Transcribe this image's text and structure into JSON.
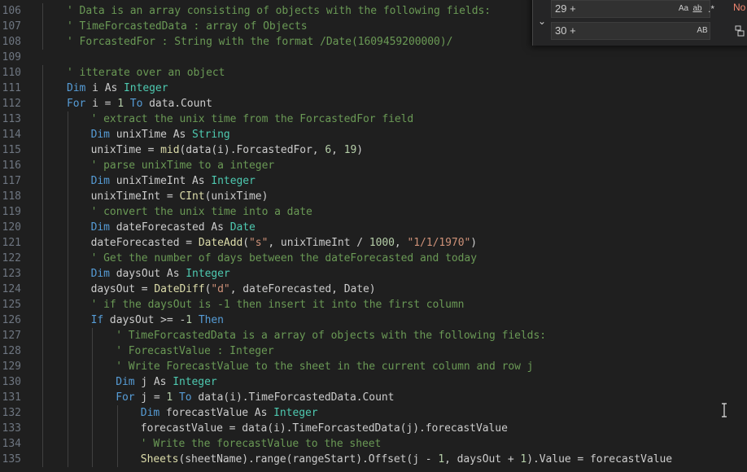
{
  "find_widget": {
    "find_value": "29 +",
    "replace_value": "30 +",
    "match_case_label": "Aa",
    "whole_word_label": "ab",
    "regex_label": ".*",
    "preserve_case_label": "AB",
    "status_text": "No"
  },
  "code_lines": [
    {
      "n": "106",
      "indent": 1,
      "tokens": [
        [
          "cm",
          "' Data is an array consisting of objects with the following fields:"
        ]
      ]
    },
    {
      "n": "107",
      "indent": 1,
      "tokens": [
        [
          "cm",
          "' TimeForcastedData : array of Objects"
        ]
      ]
    },
    {
      "n": "108",
      "indent": 1,
      "tokens": [
        [
          "cm",
          "' ForcastedFor : String with the format /Date(1609459200000)/"
        ]
      ]
    },
    {
      "n": "109",
      "indent": 0,
      "tokens": []
    },
    {
      "n": "110",
      "indent": 1,
      "tokens": [
        [
          "cm",
          "' itterate over an object"
        ]
      ]
    },
    {
      "n": "111",
      "indent": 1,
      "tokens": [
        [
          "kw",
          "Dim"
        ],
        [
          "pl",
          " i "
        ],
        [
          "pl",
          "As"
        ],
        [
          "pl",
          " "
        ],
        [
          "ty",
          "Integer"
        ]
      ]
    },
    {
      "n": "112",
      "indent": 1,
      "tokens": [
        [
          "kw",
          "For"
        ],
        [
          "pl",
          " i = "
        ],
        [
          "nu",
          "1"
        ],
        [
          "pl",
          " "
        ],
        [
          "kw",
          "To"
        ],
        [
          "pl",
          " data.Count"
        ]
      ]
    },
    {
      "n": "113",
      "indent": 2,
      "tokens": [
        [
          "cm",
          "' extract the unix time from the ForcastedFor field"
        ]
      ]
    },
    {
      "n": "114",
      "indent": 2,
      "tokens": [
        [
          "kw",
          "Dim"
        ],
        [
          "pl",
          " unixTime As "
        ],
        [
          "ty",
          "String"
        ]
      ]
    },
    {
      "n": "115",
      "indent": 2,
      "tokens": [
        [
          "pl",
          "unixTime = "
        ],
        [
          "fn",
          "mid"
        ],
        [
          "pl",
          "(data(i).ForcastedFor, "
        ],
        [
          "nu",
          "6"
        ],
        [
          "pl",
          ", "
        ],
        [
          "nu",
          "19"
        ],
        [
          "pl",
          ")"
        ]
      ]
    },
    {
      "n": "116",
      "indent": 2,
      "tokens": [
        [
          "cm",
          "' parse unixTime to a integer"
        ]
      ]
    },
    {
      "n": "117",
      "indent": 2,
      "tokens": [
        [
          "kw",
          "Dim"
        ],
        [
          "pl",
          " unixTimeInt As "
        ],
        [
          "ty",
          "Integer"
        ]
      ]
    },
    {
      "n": "118",
      "indent": 2,
      "tokens": [
        [
          "pl",
          "unixTimeInt = "
        ],
        [
          "fn",
          "CInt"
        ],
        [
          "pl",
          "(unixTime)"
        ]
      ]
    },
    {
      "n": "119",
      "indent": 2,
      "tokens": [
        [
          "cm",
          "' convert the unix time into a date"
        ]
      ]
    },
    {
      "n": "120",
      "indent": 2,
      "tokens": [
        [
          "kw",
          "Dim"
        ],
        [
          "pl",
          " dateForecasted As "
        ],
        [
          "ty",
          "Date"
        ]
      ]
    },
    {
      "n": "121",
      "indent": 2,
      "tokens": [
        [
          "pl",
          "dateForecasted = "
        ],
        [
          "fn",
          "DateAdd"
        ],
        [
          "pl",
          "("
        ],
        [
          "st",
          "\"s\""
        ],
        [
          "pl",
          ", unixTimeInt / "
        ],
        [
          "nu",
          "1000"
        ],
        [
          "pl",
          ", "
        ],
        [
          "st",
          "\"1/1/1970\""
        ],
        [
          "pl",
          ")"
        ]
      ]
    },
    {
      "n": "122",
      "indent": 2,
      "tokens": [
        [
          "cm",
          "' Get the number of days between the dateForecasted and today"
        ]
      ]
    },
    {
      "n": "123",
      "indent": 2,
      "tokens": [
        [
          "kw",
          "Dim"
        ],
        [
          "pl",
          " daysOut As "
        ],
        [
          "ty",
          "Integer"
        ]
      ]
    },
    {
      "n": "124",
      "indent": 2,
      "tokens": [
        [
          "pl",
          "daysOut = "
        ],
        [
          "fn",
          "DateDiff"
        ],
        [
          "pl",
          "("
        ],
        [
          "st",
          "\"d\""
        ],
        [
          "pl",
          ", dateForecasted, Date)"
        ]
      ]
    },
    {
      "n": "125",
      "indent": 2,
      "tokens": [
        [
          "cm",
          "' if the daysOut is -1 then insert it into the first column"
        ]
      ]
    },
    {
      "n": "126",
      "indent": 2,
      "tokens": [
        [
          "kw",
          "If"
        ],
        [
          "pl",
          " daysOut >= -"
        ],
        [
          "nu",
          "1"
        ],
        [
          "pl",
          " "
        ],
        [
          "kw",
          "Then"
        ]
      ]
    },
    {
      "n": "127",
      "indent": 3,
      "tokens": [
        [
          "cm",
          "' TimeForcastedData is a array of objects with the following fields:"
        ]
      ]
    },
    {
      "n": "128",
      "indent": 3,
      "tokens": [
        [
          "cm",
          "' ForecastValue : Integer"
        ]
      ]
    },
    {
      "n": "129",
      "indent": 3,
      "tokens": [
        [
          "cm",
          "' Write ForecastValue to the sheet in the current column and row j"
        ]
      ]
    },
    {
      "n": "130",
      "indent": 3,
      "tokens": [
        [
          "kw",
          "Dim"
        ],
        [
          "pl",
          " j As "
        ],
        [
          "ty",
          "Integer"
        ]
      ]
    },
    {
      "n": "131",
      "indent": 3,
      "tokens": [
        [
          "kw",
          "For"
        ],
        [
          "pl",
          " j = "
        ],
        [
          "nu",
          "1"
        ],
        [
          "pl",
          " "
        ],
        [
          "kw",
          "To"
        ],
        [
          "pl",
          " data(i).TimeForcastedData.Count"
        ]
      ]
    },
    {
      "n": "132",
      "indent": 4,
      "tokens": [
        [
          "kw",
          "Dim"
        ],
        [
          "pl",
          " forecastValue As "
        ],
        [
          "ty",
          "Integer"
        ]
      ]
    },
    {
      "n": "133",
      "indent": 4,
      "tokens": [
        [
          "pl",
          "forecastValue = data(i).TimeForcastedData(j).forecastValue"
        ]
      ]
    },
    {
      "n": "134",
      "indent": 4,
      "tokens": [
        [
          "cm",
          "' Write the forecastValue to the sheet"
        ]
      ]
    },
    {
      "n": "135",
      "indent": 4,
      "tokens": [
        [
          "fn",
          "Sheets"
        ],
        [
          "pl",
          "(sheetName).range(rangeStart).Offset(j - "
        ],
        [
          "nu",
          "1"
        ],
        [
          "pl",
          ", daysOut + "
        ],
        [
          "nu",
          "1"
        ],
        [
          "pl",
          ").Value = forecastValue"
        ]
      ]
    }
  ]
}
